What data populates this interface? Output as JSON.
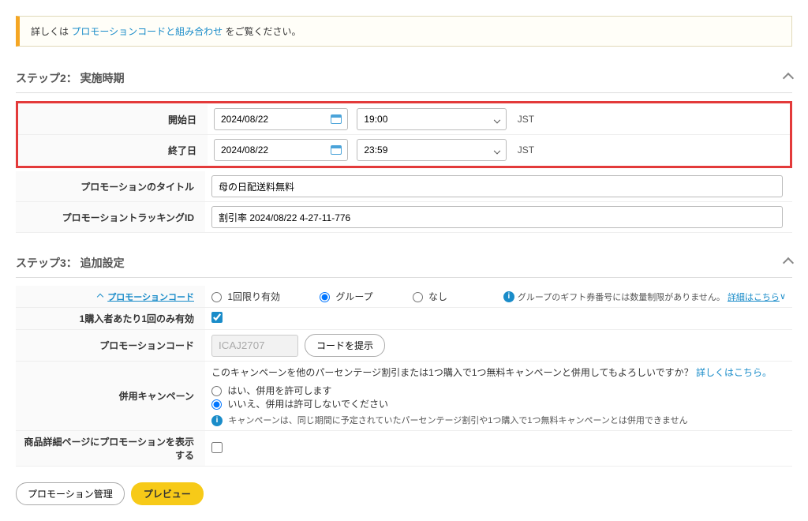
{
  "banner": {
    "prefix": "詳しくは ",
    "link": "プロモーションコードと組み合わせ",
    "suffix": " をご覧ください。"
  },
  "step2": {
    "title": "ステップ2： 実施時期",
    "startLabel": "開始日",
    "endLabel": "終了日",
    "startDate": "2024/08/22",
    "startTime": "19:00",
    "endDate": "2024/08/22",
    "endTime": "23:59",
    "tz": "JST",
    "titleLabel": "プロモーションのタイトル",
    "titleValue": "母の日配送料無料",
    "trackingLabel": "プロモーショントラッキングID",
    "trackingValue": "割引率 2024/08/22 4-27-11-776"
  },
  "step3": {
    "title": "ステップ3： 追加設定",
    "promoCodeLabel": "プロモーションコード",
    "radioOnce": "1回限り有効",
    "radioGroup": "グループ",
    "radioNone": "なし",
    "groupNote": "グループのギフト券番号には数量制限がありません。",
    "detailsLink": "詳細はこちら",
    "oncePerBuyerLabel": "1購入者あたり1回のみ有効",
    "codeFieldLabel": "プロモーションコード",
    "codeValue": "ICAJ2707",
    "codeBtn": "コードを提示",
    "combineLabel": "併用キャンペーン",
    "combineText": "このキャンペーンを他のパーセンテージ割引または1つ購入で1つ無料キャンペーンと併用してもよろしいですか？",
    "combineLink": "詳しくはこちら。",
    "combineYes": "はい、併用を許可します",
    "combineNo": "いいえ、併用は許可しないでください",
    "combineNote": "キャンペーンは、同じ期間に予定されていたパーセンテージ割引や1つ購入で1つ無料キャンペーンとは併用できません",
    "showProductLabel": "商品詳細ページにプロモーションを表示する"
  },
  "footer": {
    "manage": "プロモーション管理",
    "preview": "プレビュー"
  }
}
